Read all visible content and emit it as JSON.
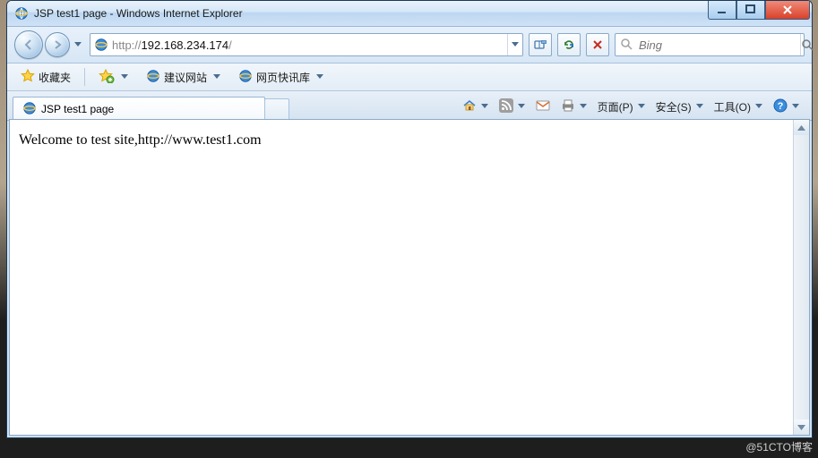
{
  "window": {
    "title": "JSP test1 page - Windows Internet Explorer"
  },
  "address": {
    "prefix": "http://",
    "host": "192.168.234.174",
    "suffix": "/"
  },
  "search": {
    "placeholder": "Bing"
  },
  "favbar": {
    "favorites_label": "收藏夹",
    "suggested_label": "建议网站",
    "webslice_label": "网页快讯库"
  },
  "tab": {
    "title": "JSP test1 page"
  },
  "commands": {
    "page": "页面(P)",
    "safety": "安全(S)",
    "tools": "工具(O)"
  },
  "page": {
    "body_text": "Welcome to test site,http://www.test1.com"
  },
  "watermark": "@51CTO博客"
}
